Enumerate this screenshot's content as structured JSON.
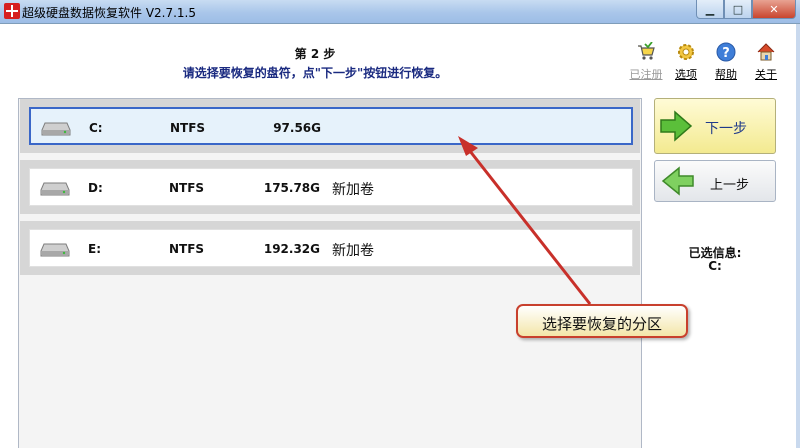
{
  "window": {
    "title": "超级硬盘数据恢复软件 V2.7.1.5"
  },
  "header": {
    "step": "第 2 步",
    "instruction": "请选择要恢复的盘符，点\"下一步\"按钮进行恢复。"
  },
  "toolbar": {
    "items": [
      {
        "label": "已注册",
        "icon": "cart-icon",
        "disabled": true
      },
      {
        "label": "选项",
        "icon": "gear-icon",
        "disabled": false
      },
      {
        "label": "帮助",
        "icon": "help-icon",
        "disabled": false
      },
      {
        "label": "关于",
        "icon": "home-icon",
        "disabled": false
      }
    ]
  },
  "disks": [
    {
      "letter": "C:",
      "fs": "NTFS",
      "size": "97.56G",
      "volume": "",
      "selected": true
    },
    {
      "letter": "D:",
      "fs": "NTFS",
      "size": "175.78G",
      "volume": "新加卷",
      "selected": false
    },
    {
      "letter": "E:",
      "fs": "NTFS",
      "size": "192.32G",
      "volume": "新加卷",
      "selected": false
    }
  ],
  "buttons": {
    "next": "下一步",
    "prev": "上一步"
  },
  "info": {
    "label": "已选信息:",
    "value": "C:"
  },
  "callout": {
    "text": "选择要恢复的分区"
  },
  "colors": {
    "selection_border": "#3a67c8",
    "callout_border": "#c8402d",
    "next_arrow": "#4aa82e"
  }
}
